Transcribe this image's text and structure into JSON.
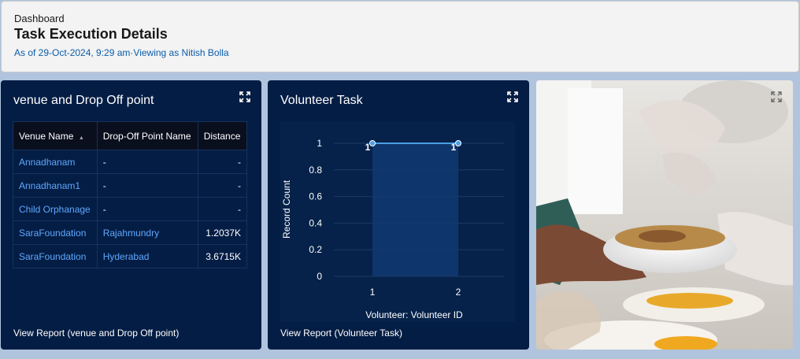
{
  "header": {
    "breadcrumb": "Dashboard",
    "title": "Task Execution Details",
    "subtitle": "As of 29-Oct-2024, 9:29 am·Viewing as Nitish Bolla"
  },
  "venue_card": {
    "title": "venue and Drop Off point",
    "columns": [
      "Venue Name",
      "Drop-Off Point Name",
      "Distance"
    ],
    "rows": [
      [
        "Annadhanam",
        "-",
        "-"
      ],
      [
        "Annadhanam1",
        "-",
        "-"
      ],
      [
        "Child Orphanage",
        "-",
        "-"
      ],
      [
        "SaraFoundation",
        "Rajahmundry",
        "1.2037K"
      ],
      [
        "SaraFoundation",
        "Hyderabad",
        "3.6715K"
      ]
    ],
    "view_report": "View Report (venue and Drop Off point)"
  },
  "volunteer_card": {
    "title": "Volunteer Task",
    "view_report": "View Report (Volunteer Task)"
  },
  "chart_data": {
    "type": "line",
    "title": "Volunteer Task",
    "xlabel": "Volunteer: Volunteer ID",
    "ylabel": "Record Count",
    "categories": [
      "1",
      "2"
    ],
    "values": [
      1,
      1
    ],
    "data_labels": [
      "1",
      "1"
    ],
    "yticks": [
      "0",
      "0.2",
      "0.4",
      "0.6",
      "0.8",
      "1"
    ],
    "ylim": [
      0,
      1
    ],
    "grid": true,
    "line_color": "#4a9fe8"
  },
  "colors": {
    "card_bg": "#041d44",
    "link": "#5fa8ff",
    "header_link": "#0b5cab"
  }
}
